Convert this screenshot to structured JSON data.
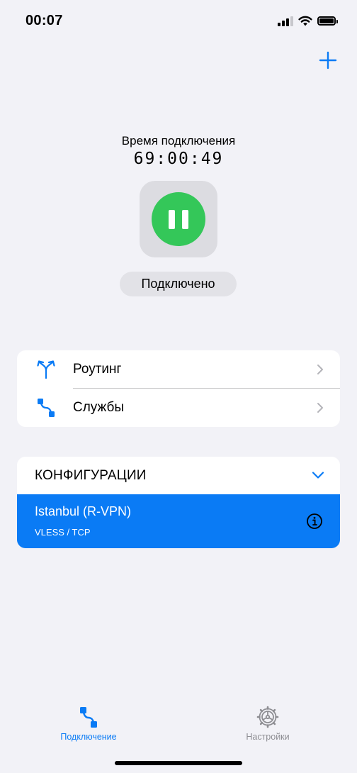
{
  "status_bar": {
    "time": "00:07",
    "icons": [
      "cellular-signal-icon",
      "wifi-icon",
      "battery-icon"
    ]
  },
  "header": {
    "add_icon": "plus-icon"
  },
  "connection": {
    "label": "Время подключения",
    "timer": "69:00:49",
    "toggle_icon": "pause-icon",
    "toggle_color": "#34c759",
    "status": "Подключено"
  },
  "menu": {
    "items": [
      {
        "label": "Роутинг",
        "icon": "routing-icon"
      },
      {
        "label": "Службы",
        "icon": "services-icon"
      }
    ]
  },
  "configurations": {
    "title": "КОНФИГУРАЦИИ",
    "expanded": true,
    "items": [
      {
        "name": "Istanbul (R-VPN)",
        "protocol": "VLESS / TCP",
        "selected": true
      }
    ],
    "accent": "#0a7bf5"
  },
  "tab_bar": {
    "tabs": [
      {
        "label": "Подключение",
        "icon": "connection-icon",
        "active": true
      },
      {
        "label": "Настройки",
        "icon": "settings-gear-icon",
        "active": false
      }
    ]
  }
}
